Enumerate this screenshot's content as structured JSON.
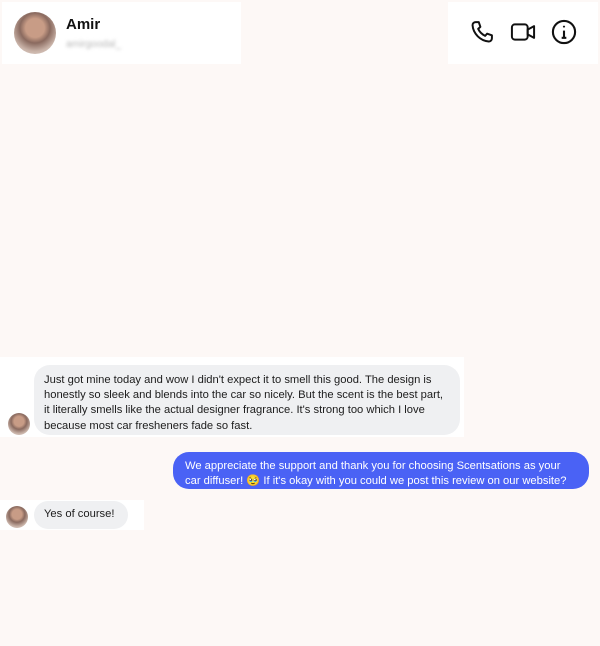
{
  "header": {
    "name": "Amir",
    "username": "amirgoodal_",
    "icons": [
      "phone-icon",
      "video-call-icon",
      "info-icon"
    ]
  },
  "messages": [
    {
      "direction": "incoming",
      "text": "Just got mine today and wow I didn't expect it to smell this good. The design is honestly so sleek and blends into the car so nicely. But the scent is the best part, it literally smells like the actual designer fragrance. It's strong too which I love because most car fresheners fade so fast."
    },
    {
      "direction": "outgoing",
      "text": "We appreciate the support and thank you for choosing Scentsations as your car diffuser! 🥹 If it's okay with you could we post this review on our website?"
    },
    {
      "direction": "incoming",
      "text": "Yes of course!"
    }
  ],
  "colors": {
    "background": "#fdf8f6",
    "incoming_bubble": "#eff0f2",
    "outgoing_bubble": "#4a62f5"
  }
}
